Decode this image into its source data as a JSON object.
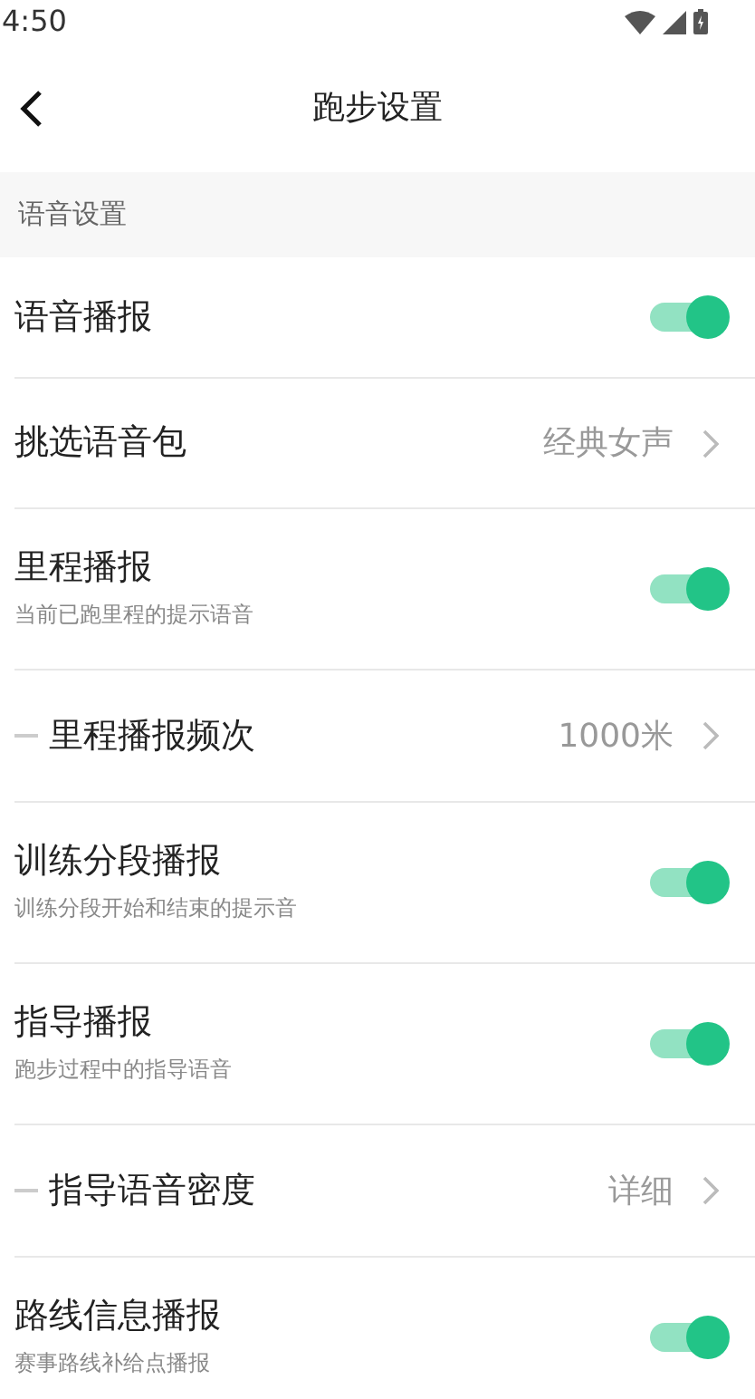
{
  "status_bar": {
    "time": "4:50"
  },
  "header": {
    "title": "跑步设置"
  },
  "section": {
    "title": "语音设置"
  },
  "settings": [
    {
      "kind": "toggle",
      "label": "语音播报",
      "on": true
    },
    {
      "kind": "select",
      "label": "挑选语音包",
      "value": "经典女声"
    },
    {
      "kind": "toggle",
      "label": "里程播报",
      "subtitle": "当前已跑里程的提示语音",
      "on": true
    },
    {
      "kind": "sub-select",
      "label": "里程播报频次",
      "value": "1000米"
    },
    {
      "kind": "toggle",
      "label": "训练分段播报",
      "subtitle": "训练分段开始和结束的提示音",
      "on": true
    },
    {
      "kind": "toggle",
      "label": "指导播报",
      "subtitle": "跑步过程中的指导语音",
      "on": true
    },
    {
      "kind": "sub-select",
      "label": "指导语音密度",
      "value": "详细"
    },
    {
      "kind": "toggle",
      "label": "路线信息播报",
      "subtitle": "赛事路线补给点播报",
      "on": true
    }
  ]
}
